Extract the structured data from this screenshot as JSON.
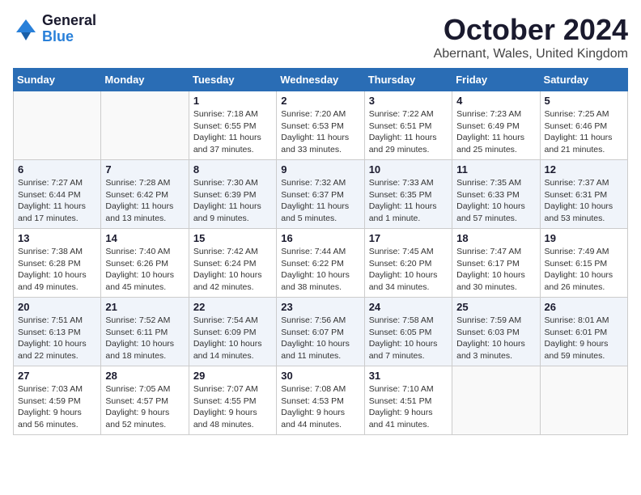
{
  "header": {
    "logo_general": "General",
    "logo_blue": "Blue",
    "month": "October 2024",
    "location": "Abernant, Wales, United Kingdom"
  },
  "weekdays": [
    "Sunday",
    "Monday",
    "Tuesday",
    "Wednesday",
    "Thursday",
    "Friday",
    "Saturday"
  ],
  "weeks": [
    [
      {
        "day": "",
        "detail": ""
      },
      {
        "day": "",
        "detail": ""
      },
      {
        "day": "1",
        "detail": "Sunrise: 7:18 AM\nSunset: 6:55 PM\nDaylight: 11 hours\nand 37 minutes."
      },
      {
        "day": "2",
        "detail": "Sunrise: 7:20 AM\nSunset: 6:53 PM\nDaylight: 11 hours\nand 33 minutes."
      },
      {
        "day": "3",
        "detail": "Sunrise: 7:22 AM\nSunset: 6:51 PM\nDaylight: 11 hours\nand 29 minutes."
      },
      {
        "day": "4",
        "detail": "Sunrise: 7:23 AM\nSunset: 6:49 PM\nDaylight: 11 hours\nand 25 minutes."
      },
      {
        "day": "5",
        "detail": "Sunrise: 7:25 AM\nSunset: 6:46 PM\nDaylight: 11 hours\nand 21 minutes."
      }
    ],
    [
      {
        "day": "6",
        "detail": "Sunrise: 7:27 AM\nSunset: 6:44 PM\nDaylight: 11 hours\nand 17 minutes."
      },
      {
        "day": "7",
        "detail": "Sunrise: 7:28 AM\nSunset: 6:42 PM\nDaylight: 11 hours\nand 13 minutes."
      },
      {
        "day": "8",
        "detail": "Sunrise: 7:30 AM\nSunset: 6:39 PM\nDaylight: 11 hours\nand 9 minutes."
      },
      {
        "day": "9",
        "detail": "Sunrise: 7:32 AM\nSunset: 6:37 PM\nDaylight: 11 hours\nand 5 minutes."
      },
      {
        "day": "10",
        "detail": "Sunrise: 7:33 AM\nSunset: 6:35 PM\nDaylight: 11 hours\nand 1 minute."
      },
      {
        "day": "11",
        "detail": "Sunrise: 7:35 AM\nSunset: 6:33 PM\nDaylight: 10 hours\nand 57 minutes."
      },
      {
        "day": "12",
        "detail": "Sunrise: 7:37 AM\nSunset: 6:31 PM\nDaylight: 10 hours\nand 53 minutes."
      }
    ],
    [
      {
        "day": "13",
        "detail": "Sunrise: 7:38 AM\nSunset: 6:28 PM\nDaylight: 10 hours\nand 49 minutes."
      },
      {
        "day": "14",
        "detail": "Sunrise: 7:40 AM\nSunset: 6:26 PM\nDaylight: 10 hours\nand 45 minutes."
      },
      {
        "day": "15",
        "detail": "Sunrise: 7:42 AM\nSunset: 6:24 PM\nDaylight: 10 hours\nand 42 minutes."
      },
      {
        "day": "16",
        "detail": "Sunrise: 7:44 AM\nSunset: 6:22 PM\nDaylight: 10 hours\nand 38 minutes."
      },
      {
        "day": "17",
        "detail": "Sunrise: 7:45 AM\nSunset: 6:20 PM\nDaylight: 10 hours\nand 34 minutes."
      },
      {
        "day": "18",
        "detail": "Sunrise: 7:47 AM\nSunset: 6:17 PM\nDaylight: 10 hours\nand 30 minutes."
      },
      {
        "day": "19",
        "detail": "Sunrise: 7:49 AM\nSunset: 6:15 PM\nDaylight: 10 hours\nand 26 minutes."
      }
    ],
    [
      {
        "day": "20",
        "detail": "Sunrise: 7:51 AM\nSunset: 6:13 PM\nDaylight: 10 hours\nand 22 minutes."
      },
      {
        "day": "21",
        "detail": "Sunrise: 7:52 AM\nSunset: 6:11 PM\nDaylight: 10 hours\nand 18 minutes."
      },
      {
        "day": "22",
        "detail": "Sunrise: 7:54 AM\nSunset: 6:09 PM\nDaylight: 10 hours\nand 14 minutes."
      },
      {
        "day": "23",
        "detail": "Sunrise: 7:56 AM\nSunset: 6:07 PM\nDaylight: 10 hours\nand 11 minutes."
      },
      {
        "day": "24",
        "detail": "Sunrise: 7:58 AM\nSunset: 6:05 PM\nDaylight: 10 hours\nand 7 minutes."
      },
      {
        "day": "25",
        "detail": "Sunrise: 7:59 AM\nSunset: 6:03 PM\nDaylight: 10 hours\nand 3 minutes."
      },
      {
        "day": "26",
        "detail": "Sunrise: 8:01 AM\nSunset: 6:01 PM\nDaylight: 9 hours\nand 59 minutes."
      }
    ],
    [
      {
        "day": "27",
        "detail": "Sunrise: 7:03 AM\nSunset: 4:59 PM\nDaylight: 9 hours\nand 56 minutes."
      },
      {
        "day": "28",
        "detail": "Sunrise: 7:05 AM\nSunset: 4:57 PM\nDaylight: 9 hours\nand 52 minutes."
      },
      {
        "day": "29",
        "detail": "Sunrise: 7:07 AM\nSunset: 4:55 PM\nDaylight: 9 hours\nand 48 minutes."
      },
      {
        "day": "30",
        "detail": "Sunrise: 7:08 AM\nSunset: 4:53 PM\nDaylight: 9 hours\nand 44 minutes."
      },
      {
        "day": "31",
        "detail": "Sunrise: 7:10 AM\nSunset: 4:51 PM\nDaylight: 9 hours\nand 41 minutes."
      },
      {
        "day": "",
        "detail": ""
      },
      {
        "day": "",
        "detail": ""
      }
    ]
  ]
}
